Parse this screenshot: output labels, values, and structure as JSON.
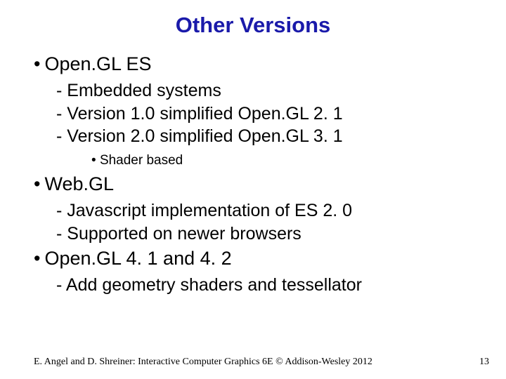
{
  "title": "Other Versions",
  "sections": [
    {
      "heading": "Open.GL ES",
      "items": [
        "Embedded systems",
        "Version 1.0 simplified Open.GL 2. 1",
        "Version 2.0 simplified Open.GL 3. 1"
      ],
      "subbullet": "Shader based"
    },
    {
      "heading": "Web.GL",
      "items": [
        "Javascript implementation of ES 2. 0",
        "Supported on newer browsers"
      ]
    },
    {
      "heading": "Open.GL 4. 1 and 4. 2",
      "items": [
        "Add geometry shaders and tessellator"
      ]
    }
  ],
  "footer": "E. Angel and D. Shreiner: Interactive Computer Graphics 6E © Addison-Wesley 2012",
  "pageNumber": "13"
}
